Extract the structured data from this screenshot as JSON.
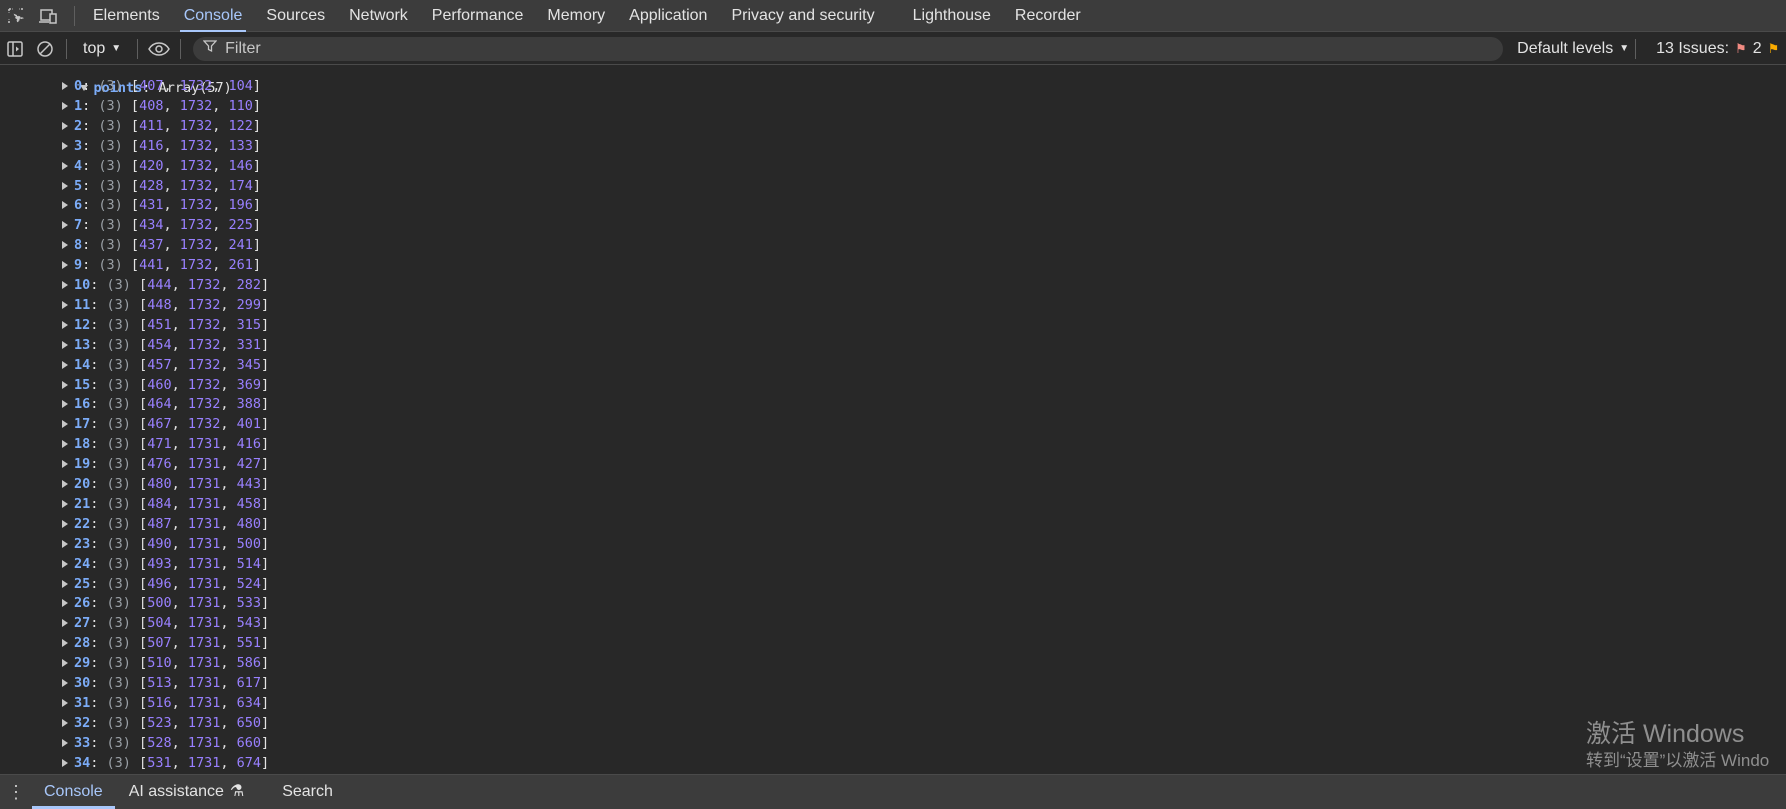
{
  "tabs": [
    {
      "label": "Elements"
    },
    {
      "label": "Console"
    },
    {
      "label": "Sources"
    },
    {
      "label": "Network"
    },
    {
      "label": "Performance"
    },
    {
      "label": "Memory"
    },
    {
      "label": "Application"
    },
    {
      "label": "Privacy and security"
    },
    {
      "label": "Lighthouse"
    },
    {
      "label": "Recorder"
    }
  ],
  "active_tab": "Console",
  "toolbar": {
    "context": "top",
    "filter_placeholder": "Filter",
    "levels": "Default levels",
    "issues_label": "13 Issues:",
    "issues_count": "2"
  },
  "output": {
    "parent_key": "points",
    "parent_value": "Array(57)",
    "entries": [
      {
        "i": "0",
        "v": [
          407,
          1732,
          104
        ]
      },
      {
        "i": "1",
        "v": [
          408,
          1732,
          110
        ]
      },
      {
        "i": "2",
        "v": [
          411,
          1732,
          122
        ]
      },
      {
        "i": "3",
        "v": [
          416,
          1732,
          133
        ]
      },
      {
        "i": "4",
        "v": [
          420,
          1732,
          146
        ]
      },
      {
        "i": "5",
        "v": [
          428,
          1732,
          174
        ]
      },
      {
        "i": "6",
        "v": [
          431,
          1732,
          196
        ]
      },
      {
        "i": "7",
        "v": [
          434,
          1732,
          225
        ]
      },
      {
        "i": "8",
        "v": [
          437,
          1732,
          241
        ]
      },
      {
        "i": "9",
        "v": [
          441,
          1732,
          261
        ]
      },
      {
        "i": "10",
        "v": [
          444,
          1732,
          282
        ]
      },
      {
        "i": "11",
        "v": [
          448,
          1732,
          299
        ]
      },
      {
        "i": "12",
        "v": [
          451,
          1732,
          315
        ]
      },
      {
        "i": "13",
        "v": [
          454,
          1732,
          331
        ]
      },
      {
        "i": "14",
        "v": [
          457,
          1732,
          345
        ]
      },
      {
        "i": "15",
        "v": [
          460,
          1732,
          369
        ]
      },
      {
        "i": "16",
        "v": [
          464,
          1732,
          388
        ]
      },
      {
        "i": "17",
        "v": [
          467,
          1732,
          401
        ]
      },
      {
        "i": "18",
        "v": [
          471,
          1731,
          416
        ]
      },
      {
        "i": "19",
        "v": [
          476,
          1731,
          427
        ]
      },
      {
        "i": "20",
        "v": [
          480,
          1731,
          443
        ]
      },
      {
        "i": "21",
        "v": [
          484,
          1731,
          458
        ]
      },
      {
        "i": "22",
        "v": [
          487,
          1731,
          480
        ]
      },
      {
        "i": "23",
        "v": [
          490,
          1731,
          500
        ]
      },
      {
        "i": "24",
        "v": [
          493,
          1731,
          514
        ]
      },
      {
        "i": "25",
        "v": [
          496,
          1731,
          524
        ]
      },
      {
        "i": "26",
        "v": [
          500,
          1731,
          533
        ]
      },
      {
        "i": "27",
        "v": [
          504,
          1731,
          543
        ]
      },
      {
        "i": "28",
        "v": [
          507,
          1731,
          551
        ]
      },
      {
        "i": "29",
        "v": [
          510,
          1731,
          586
        ]
      },
      {
        "i": "30",
        "v": [
          513,
          1731,
          617
        ]
      },
      {
        "i": "31",
        "v": [
          516,
          1731,
          634
        ]
      },
      {
        "i": "32",
        "v": [
          523,
          1731,
          650
        ]
      },
      {
        "i": "33",
        "v": [
          528,
          1731,
          660
        ]
      },
      {
        "i": "34",
        "v": [
          531,
          1731,
          674
        ]
      }
    ]
  },
  "watermark": {
    "line1": "激活 Windows",
    "line2": "转到“设置”以激活 Windo"
  },
  "drawer": {
    "tabs": [
      {
        "label": "Console"
      },
      {
        "label": "AI assistance"
      },
      {
        "label": "Search"
      }
    ]
  },
  "colors": {
    "accent": "#a8c7fa",
    "key": "#7cacf8",
    "number": "#9980ff",
    "background": "#282828"
  }
}
